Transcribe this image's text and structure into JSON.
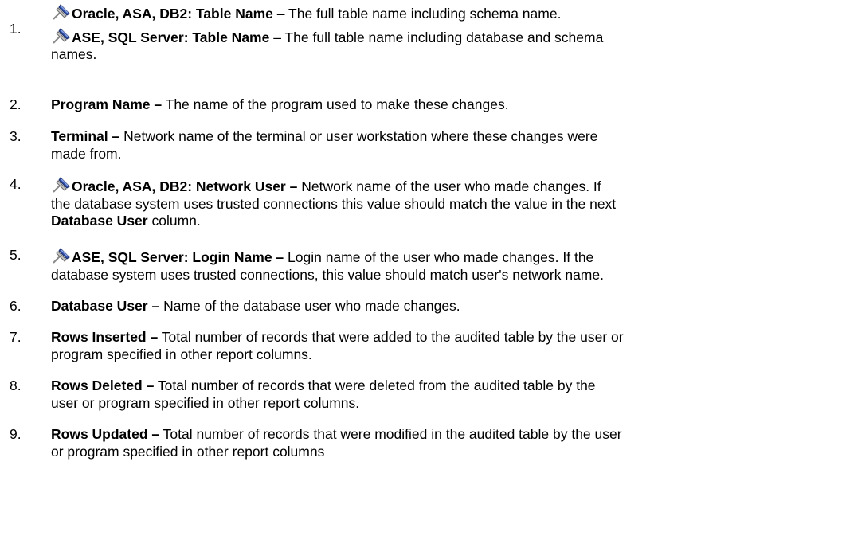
{
  "items": [
    {
      "number": "1.",
      "entries": [
        {
          "bold": "Oracle, ASA, DB2: Table Name",
          "rest": " – The full table name including schema name.",
          "rest2": ""
        },
        {
          "bold": "ASE, SQL Server:  Table Name",
          "rest": " – The full table name including database and schema",
          "rest2": "names."
        }
      ]
    },
    {
      "number": "2.",
      "bold": "Program Name –",
      "l1": " The name of the program used to make these changes.",
      "l2": ""
    },
    {
      "number": "3.",
      "bold": "Terminal –",
      "l1": " Network name of the terminal or user workstation where these changes were",
      "l2": "made from."
    },
    {
      "number": "4.",
      "bold": "Oracle, ASA, DB2: Network User –",
      "l1": " Network name of the user who made changes. If",
      "l2": "the database system uses trusted connections this value should match the value in the next",
      "l3_bold": "Database User",
      "l3": " column."
    },
    {
      "number": "5.",
      "bold": "ASE, SQL Server: Login Name –",
      "l1": " Login name of the user who made changes. If the",
      "l2": "database system uses trusted connections, this value should match user's network name."
    },
    {
      "number": "6.",
      "bold": "Database User –",
      "l1": " Name of the database user who made changes.",
      "l2": ""
    },
    {
      "number": "7.",
      "bold": "Rows Inserted –",
      "l1": " Total number of records that were added to the audited table by the user or",
      "l2": "program specified in other report columns."
    },
    {
      "number": "8.",
      "bold": "Rows Deleted –",
      "l1": " Total number of records that were deleted from the audited table by the",
      "l2": "user or program specified in other report columns."
    },
    {
      "number": "9.",
      "bold": "Rows Updated –",
      "l1": " Total number of records that were modified in the audited table by the  user",
      "l2": "or program specified in other report columns"
    }
  ],
  "icons": {
    "pin": "pushpin-icon"
  }
}
